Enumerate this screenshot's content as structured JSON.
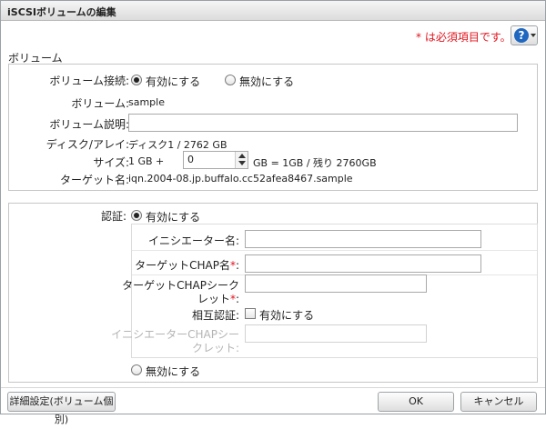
{
  "window": {
    "title": "iSCSIボリュームの編集"
  },
  "header": {
    "required_note": "* は必須項目です。",
    "help_icon": "question-circle-icon",
    "help_label": "?"
  },
  "volume_section": {
    "title": "ボリューム",
    "connection": {
      "label": "ボリューム接続:",
      "options": [
        "有効にする",
        "無効にする"
      ],
      "selected": "有効にする"
    },
    "name": {
      "label": "ボリューム:",
      "value": "sample"
    },
    "description": {
      "label": "ボリューム説明:",
      "value": ""
    },
    "disk": {
      "label": "ディスク/アレイ:",
      "value": "ディスク1 / 2762 GB"
    },
    "size": {
      "label": "サイズ:",
      "prefix": "1 GB +",
      "value": "0",
      "suffix": "GB = 1GB / 残り 2760GB"
    },
    "target": {
      "label": "ターゲット名:",
      "value": "iqn.2004-08.jp.buffalo.cc52afea8467.sample"
    }
  },
  "auth_section": {
    "label": "認証:",
    "enable_label": "有効にする",
    "disable_label": "無効にする",
    "selected": "有効にする",
    "initiator_name": {
      "label": "イニシエーター名:",
      "value": ""
    },
    "target_chap_name": {
      "label": "ターゲットCHAP名",
      "req": "*",
      "colon": ":",
      "value": ""
    },
    "target_chap_secret": {
      "label1": "ターゲットCHAPシーク",
      "label2": "レット",
      "req": "*",
      "colon": ":",
      "value": ""
    },
    "mutual_auth": {
      "label": "相互認証:",
      "checkbox_label": "有効にする",
      "checked": false
    },
    "initiator_chap_secret": {
      "label1": "イニシエーターCHAPシー",
      "label2": "クレット:",
      "value": "",
      "disabled": true
    }
  },
  "footer": {
    "advanced_button": "詳細設定(ボリューム個別)",
    "ok_button": "OK",
    "cancel_button": "キャンセル"
  }
}
